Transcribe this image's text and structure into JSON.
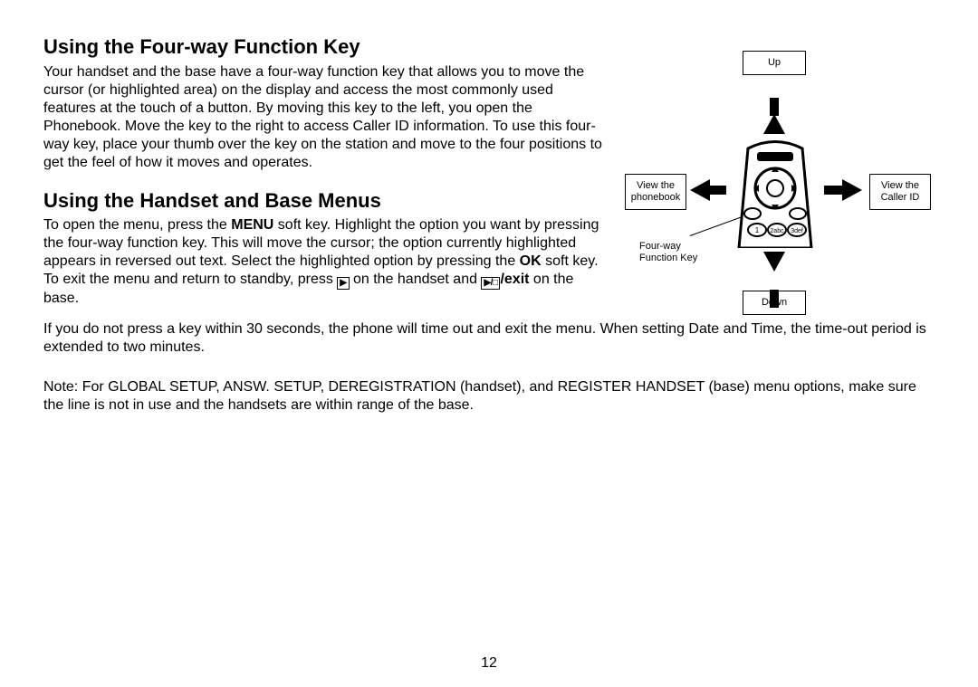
{
  "page_number": "12",
  "section1": {
    "heading": "Using the Four-way Function Key",
    "body": "Your handset and the base have a four-way function key that allows you to move the cursor (or highlighted area) on the display and access the most commonly used features at the touch of a button. By moving this key to the left, you open the Phonebook. Move the key to the right to access Caller ID information. To use this four-way key, place your thumb over the key on the station and move to the four positions to get the feel of how it moves and operates."
  },
  "section2": {
    "heading": "Using the Handset and Base Menus",
    "body_pre": "To open the menu, press the ",
    "menu_bold": "MENU",
    "body_mid1": " soft key. Highlight the option you want by pressing the four-way function key. This will move the cursor; the option currently highlighted appears in reversed out text. Select the highlighted option by pressing the ",
    "ok_bold": "OK",
    "body_mid2": " soft key. To exit the menu and return to standby, press ",
    "body_mid3": " on the handset and ",
    "exit_bold": "/exit",
    "body_end": " on the base.",
    "timeout_text": "If you do not press a key within 30 seconds, the phone will time out and exit the menu. When setting Date and Time, the time-out period is extended to two minutes.",
    "note_text": "Note: For GLOBAL SETUP, ANSW. SETUP, DEREGISTRATION (handset), and REGISTER HANDSET (base) menu options, make sure the line is not in use and the handsets are within range of the base."
  },
  "diagram": {
    "up": "Up",
    "down": "Down",
    "left_line1": "View the",
    "left_line2": "phonebook",
    "right_line1": "View the",
    "right_line2": "Caller ID",
    "fnkey_line1": "Four-way",
    "fnkey_line2": "Function Key",
    "handset_icon1": "▶",
    "handset_icon2": "▶/□"
  }
}
